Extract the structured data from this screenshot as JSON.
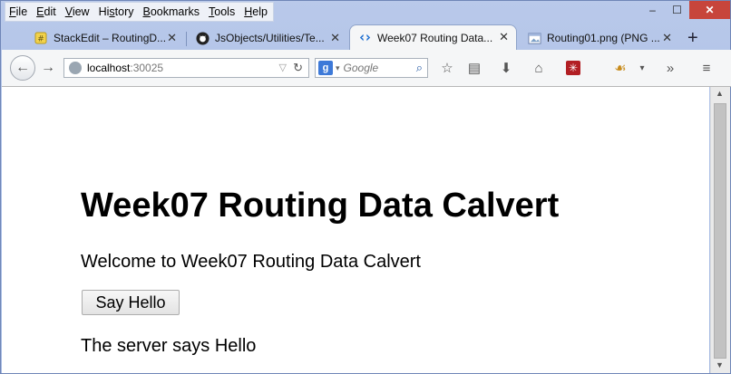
{
  "menu": [
    {
      "label": "File",
      "key": "F"
    },
    {
      "label": "Edit",
      "key": "E"
    },
    {
      "label": "View",
      "key": "V"
    },
    {
      "label": "History",
      "key": "s"
    },
    {
      "label": "Bookmarks",
      "key": "B"
    },
    {
      "label": "Tools",
      "key": "T"
    },
    {
      "label": "Help",
      "key": "H"
    }
  ],
  "window_controls": {
    "minimize": "‒",
    "maximize": "☐",
    "close": "✕"
  },
  "tabs": [
    {
      "label": "StackEdit – RoutingD...",
      "icon": "stackedit-icon"
    },
    {
      "label": "JsObjects/Utilities/Te...",
      "icon": "github-icon"
    },
    {
      "label": "Week07 Routing Data...",
      "icon": "vs-icon",
      "active": true
    },
    {
      "label": "Routing01.png (PNG ...",
      "icon": "image-icon"
    }
  ],
  "tab_close": "✕",
  "new_tab": "+",
  "url": {
    "host": "localhost",
    "port": ":30025"
  },
  "search": {
    "engine_letter": "g",
    "placeholder": "Google"
  },
  "page": {
    "title": "Week07 Routing Data Calvert",
    "welcome": "Welcome to Week07 Routing Data Calvert",
    "button_label": "Say Hello",
    "server_message": "The server says Hello"
  }
}
